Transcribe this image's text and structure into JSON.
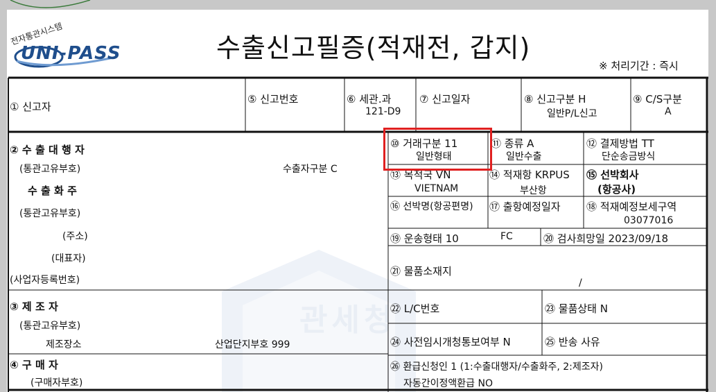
{
  "header": {
    "logo_text": "UNI-PASS",
    "seal_text": "전자통관시스템",
    "title": "수출신고필증(적재전, 갑지)",
    "processing_period": "※ 처리기간 : 즉시"
  },
  "watermark": {
    "text": "관세청"
  },
  "row1": {
    "declarant": "① 신고자",
    "declaration_no_label": "⑤ 신고번호",
    "customs_label": "⑥ 세관.과",
    "customs_value": "121-D9",
    "declaration_date_label": "⑦ 신고일자",
    "declaration_type_label": "⑧ 신고구분 H",
    "declaration_type_value": "일반P/L신고",
    "cs_label": "⑨ C/S구분",
    "cs_value": "A"
  },
  "left": {
    "exporter_agent": "② 수 출 대 행 자",
    "customs_id_1": "(통관고유부호)",
    "exporter_type": "수출자구분 C",
    "exporter_owner": "수 출 화 주",
    "customs_id_2": "(통관고유부호)",
    "address": "(주소)",
    "representative": "(대표자)",
    "business_no": "(사업자등록번호)",
    "manufacturer": "③ 제 조 자",
    "customs_id_3": "(통관고유부호)",
    "factory": "제조장소",
    "industrial_complex": "산업단지부호 999",
    "buyer": "④ 구 매 자",
    "buyer_code": "(구매자부호)"
  },
  "right": {
    "trade_type": "⑩ 거래구분  11",
    "trade_type_value": "일반형태",
    "kind": "⑪ 종류 A",
    "kind_value": "일반수출",
    "payment": "⑫ 결제방법  TT",
    "payment_value": "단순송금방식",
    "destination": "⑬ 목적국      VN",
    "destination_value": "VIETNAM",
    "loading_port": "⑭ 적재항    KRPUS",
    "loading_port_value": "부산항",
    "carrier": "⑮ 선박회사",
    "carrier_sub": "(항공사)",
    "vessel_name": "⑯ 선박명(항공편명)",
    "departure_date": "⑰ 출항예정일자",
    "bonded_area": "⑱ 적재예정보세구역",
    "bonded_area_value": "03077016",
    "transport": "⑲ 운송형태  10",
    "transport_code": "FC",
    "inspection_date": "⑳ 검사희망일  2023/09/18",
    "goods_location": "㉑ 물품소재지",
    "goods_location_tail": "/",
    "lc_no": "㉒ L/C번호",
    "goods_state": "㉓ 물품상태  N",
    "pre_notice": "㉔ 사전임시개청통보여부      N",
    "return_reason": "㉕ 반송 사유",
    "refund_applicant": "㉖ 환급신청인   1   (1:수출대행자/수출화주, 2:제조자)",
    "auto_refund": "자동간이정액환급   NO"
  },
  "colors": {
    "highlight": "#e02020",
    "logo": "#1f4e8c",
    "rule": "#111111"
  }
}
